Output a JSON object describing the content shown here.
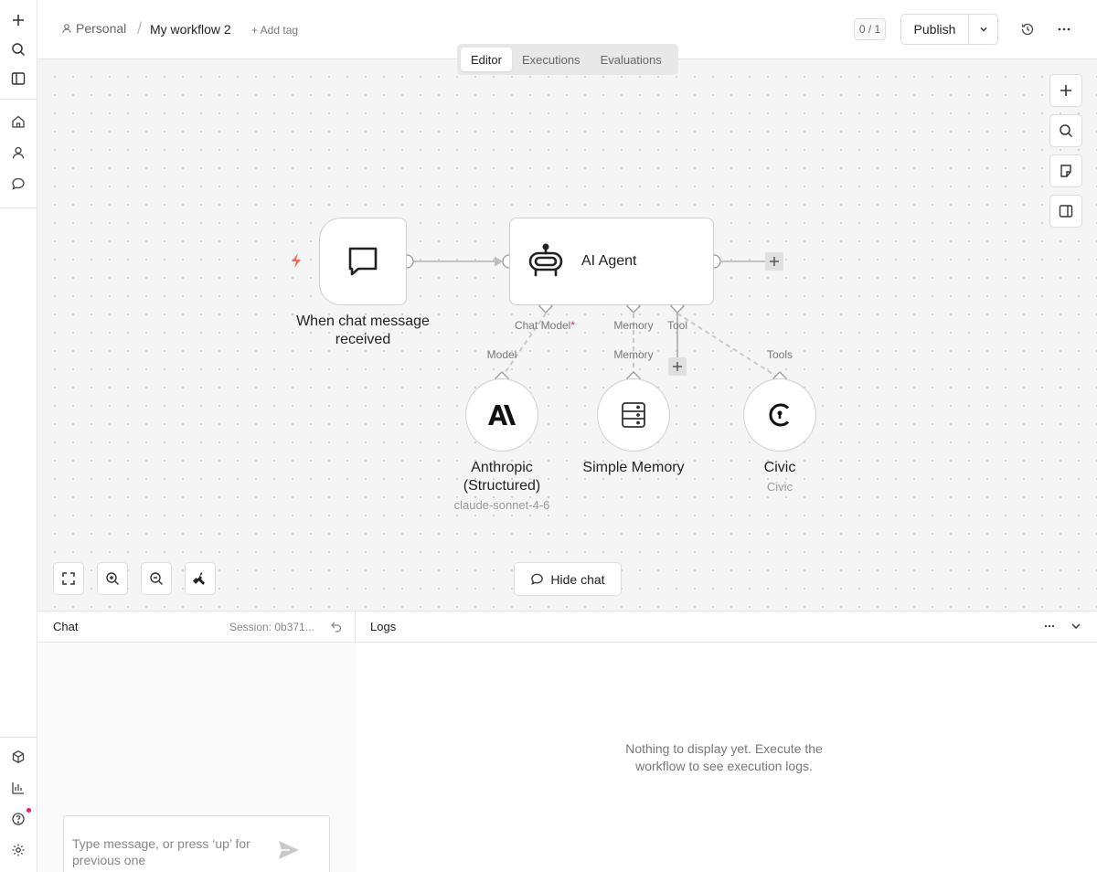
{
  "header": {
    "project": "Personal",
    "workflow_name": "My workflow 2",
    "add_tag": "+ Add tag",
    "counter": "0 / 1",
    "publish_label": "Publish"
  },
  "tabs": [
    {
      "label": "Editor",
      "active": true
    },
    {
      "label": "Executions",
      "active": false
    },
    {
      "label": "Evaluations",
      "active": false
    }
  ],
  "nodes": {
    "trigger": {
      "label": "When chat message received",
      "icon": "chat-bubble-icon"
    },
    "agent": {
      "label": "AI Agent",
      "icon": "robot-icon"
    },
    "model": {
      "label": "Anthropic (Structured)",
      "subtitle": "claude-sonnet-4-6",
      "icon": "anthropic-icon"
    },
    "memory": {
      "label": "Simple Memory",
      "icon": "database-icon"
    },
    "tool": {
      "label": "Civic",
      "subtitle": "Civic",
      "icon": "civic-icon"
    }
  },
  "ports": {
    "chat_model": "Chat Model",
    "chat_model_required": "*",
    "memory": "Memory",
    "tool": "Tool",
    "model_in": "Model",
    "memory_in": "Memory",
    "tools_in": "Tools"
  },
  "canvas": {
    "hide_chat": "Hide chat"
  },
  "chat": {
    "title": "Chat",
    "session": "Session: 0b371...",
    "placeholder": "Type message, or press ‘up’ for previous one"
  },
  "logs": {
    "title": "Logs",
    "empty": "Nothing to display yet. Execute the workflow to see execution logs."
  },
  "colors": {
    "canvas_bg": "#f5f5f5",
    "required": "#e0244e",
    "trigger_bolt": "#f26a5a"
  }
}
